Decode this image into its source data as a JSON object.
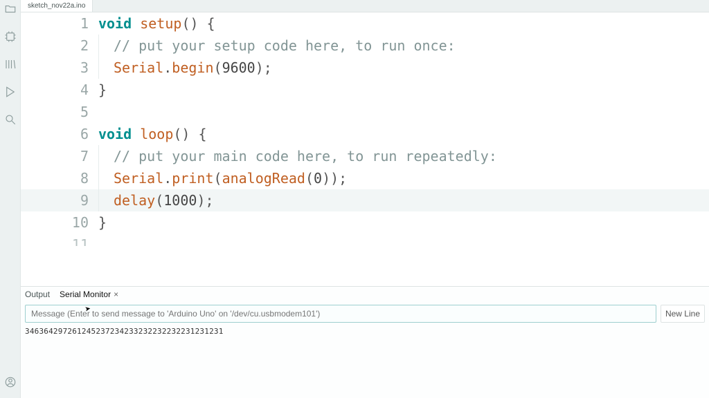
{
  "tab": {
    "filename": "sketch_nov22a.ino"
  },
  "code": {
    "lines": [
      {
        "n": 1,
        "hl": false,
        "indent": false
      },
      {
        "n": 2,
        "hl": false,
        "indent": true
      },
      {
        "n": 3,
        "hl": false,
        "indent": true
      },
      {
        "n": 4,
        "hl": false,
        "indent": false
      },
      {
        "n": 5,
        "hl": false,
        "indent": false
      },
      {
        "n": 6,
        "hl": false,
        "indent": false
      },
      {
        "n": 7,
        "hl": false,
        "indent": true
      },
      {
        "n": 8,
        "hl": false,
        "indent": true
      },
      {
        "n": 9,
        "hl": true,
        "indent": true
      },
      {
        "n": 10,
        "hl": false,
        "indent": false
      },
      {
        "n": 11,
        "hl": false,
        "indent": false,
        "partial": true
      }
    ],
    "tokens": {
      "void": "void",
      "setup": "setup",
      "loop": "loop",
      "Serial": "Serial",
      "begin": "begin",
      "print": "print",
      "analogRead": "analogRead",
      "delay": "delay",
      "baud": "9600",
      "pin": "0",
      "ms": "1000",
      "comment_setup": "// put your setup code here, to run once:",
      "comment_loop": "// put your main code here, to run repeatedly:"
    }
  },
  "panel": {
    "tab_output": "Output",
    "tab_serial": "Serial Monitor",
    "input_placeholder": "Message (Enter to send message to 'Arduino Uno' on '/dev/cu.usbmodem101')",
    "newline": "New Line",
    "serial_data": "346364297261245237234233232232232231231231"
  }
}
